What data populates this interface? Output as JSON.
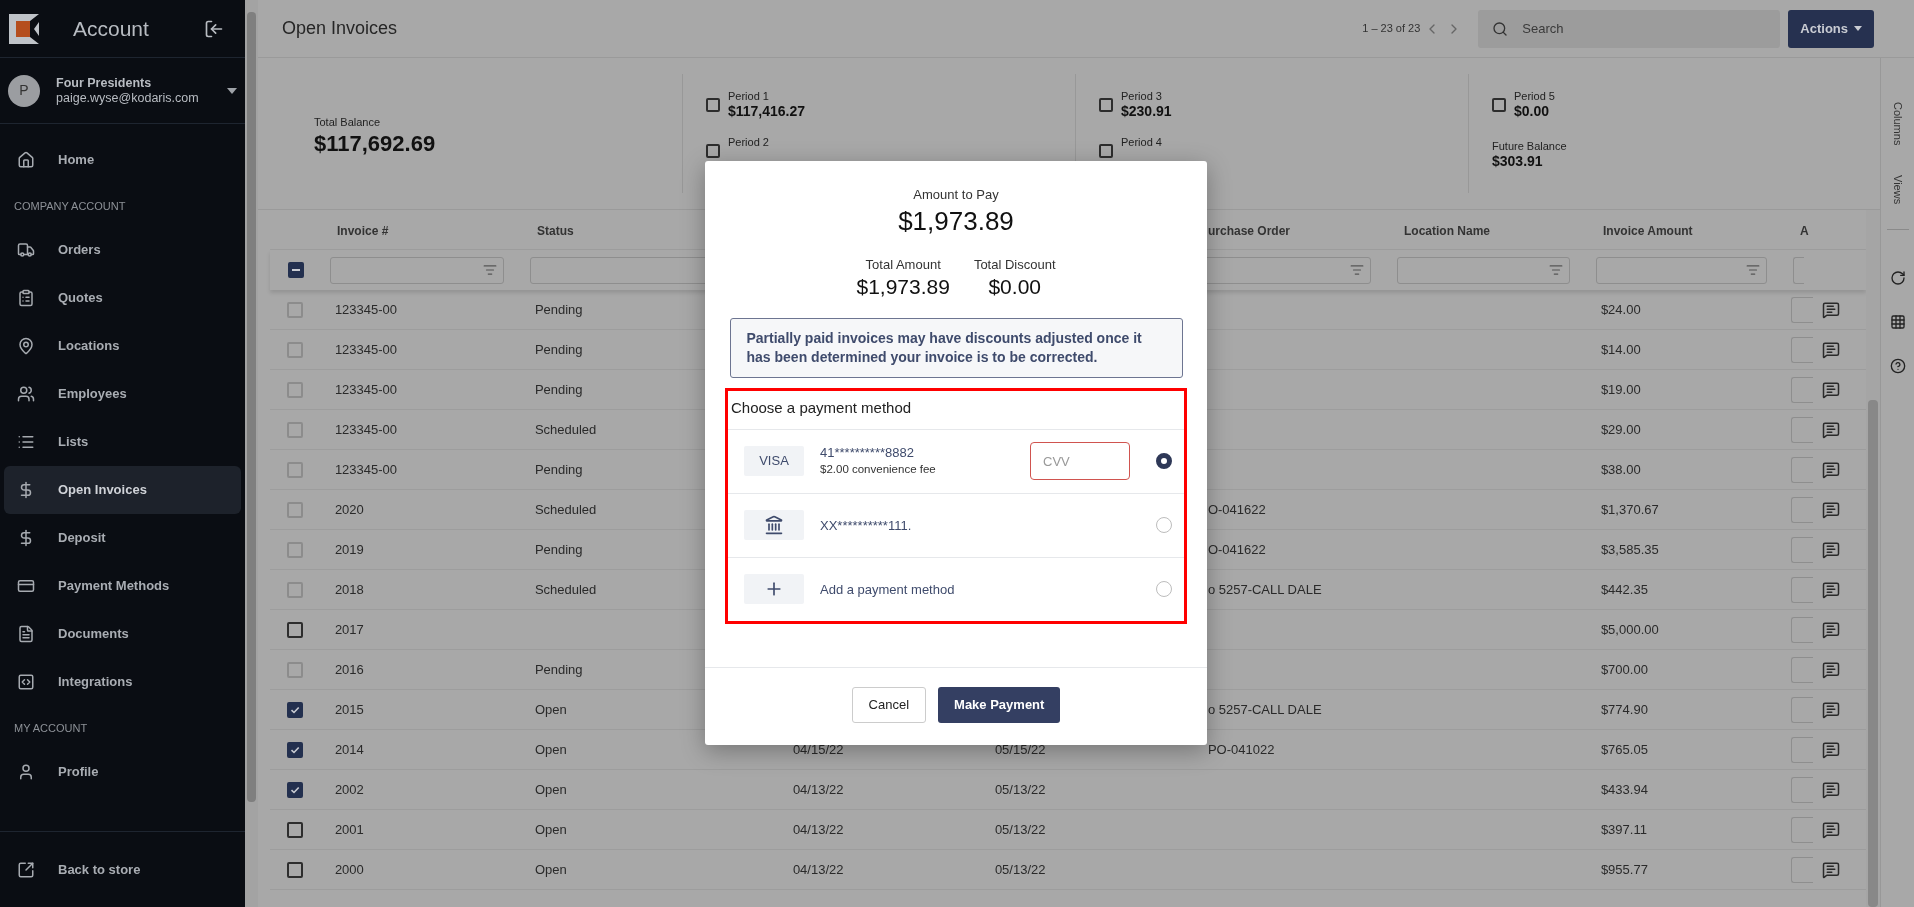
{
  "sidebar": {
    "title": "Account",
    "user": {
      "initial": "P",
      "name": "Four Presidents",
      "email": "paige.wyse@kodaris.com"
    },
    "sections": [
      {
        "items": [
          {
            "label": "Home",
            "selected": false
          }
        ]
      },
      {
        "heading": "COMPANY ACCOUNT",
        "items": [
          {
            "label": "Orders",
            "selected": false
          },
          {
            "label": "Quotes",
            "selected": false
          },
          {
            "label": "Locations",
            "selected": false
          },
          {
            "label": "Employees",
            "selected": false
          },
          {
            "label": "Lists",
            "selected": false
          },
          {
            "label": "Open Invoices",
            "selected": true
          },
          {
            "label": "Deposit",
            "selected": false
          },
          {
            "label": "Payment Methods",
            "selected": false
          },
          {
            "label": "Documents",
            "selected": false
          },
          {
            "label": "Integrations",
            "selected": false
          }
        ]
      },
      {
        "heading": "MY ACCOUNT",
        "items": [
          {
            "label": "Profile",
            "selected": false
          }
        ]
      }
    ],
    "footer": "Back to store"
  },
  "header": {
    "title": "Open Invoices",
    "pagination": "1 – 23 of 23",
    "search": {
      "placeholder": "Search"
    },
    "actions": "Actions"
  },
  "summary": {
    "total_balance": {
      "label": "Total Balance",
      "value": "$117,692.69"
    },
    "periods": [
      {
        "label": "Period 1",
        "value": "$117,416.27",
        "checked": false
      },
      {
        "label": "Period 2",
        "checked": false
      },
      {
        "label": "Period 3",
        "value": "$230.91",
        "checked": false
      },
      {
        "label": "Period 4",
        "checked": false
      },
      {
        "label": "Period 5",
        "value": "$0.00",
        "checked": false
      }
    ],
    "future_balance": {
      "label": "Future Balance",
      "value": "$303.91"
    }
  },
  "side_tabs": [
    "Columns",
    "Views"
  ],
  "table": {
    "select_all": {
      "indeterminate": true
    },
    "columns": [
      {
        "label": "Invoice #"
      },
      {
        "label": "Status"
      },
      {},
      {},
      {
        "label": "urchase Order"
      },
      {
        "label": "Location Name"
      },
      {
        "label": "Invoice Amount"
      },
      {
        "label": "A"
      }
    ],
    "rows": [
      {
        "checked": false,
        "disabled": true,
        "cells": {
          "invoice": "123345-00",
          "status": "Pending",
          "invoice_amount": "$24.00"
        }
      },
      {
        "checked": false,
        "disabled": true,
        "cells": {
          "invoice": "123345-00",
          "status": "Pending",
          "invoice_amount": "$14.00"
        }
      },
      {
        "checked": false,
        "disabled": true,
        "cells": {
          "invoice": "123345-00",
          "status": "Pending",
          "invoice_amount": "$19.00"
        }
      },
      {
        "checked": false,
        "disabled": true,
        "cells": {
          "invoice": "123345-00",
          "status": "Scheduled",
          "invoice_amount": "$29.00"
        }
      },
      {
        "checked": false,
        "disabled": true,
        "cells": {
          "invoice": "123345-00",
          "status": "Pending",
          "invoice_amount": "$38.00"
        }
      },
      {
        "checked": false,
        "disabled": true,
        "cells": {
          "invoice": "2020",
          "status": "Scheduled",
          "purchase_order": "O-041622",
          "invoice_amount": "$1,370.67"
        }
      },
      {
        "checked": false,
        "disabled": true,
        "cells": {
          "invoice": "2019",
          "status": "Pending",
          "purchase_order": "O-041622",
          "invoice_amount": "$3,585.35"
        }
      },
      {
        "checked": false,
        "disabled": true,
        "cells": {
          "invoice": "2018",
          "status": "Scheduled",
          "purchase_order": "o 5257-CALL DALE",
          "invoice_amount": "$442.35"
        }
      },
      {
        "checked": false,
        "disabled": false,
        "cells": {
          "invoice": "2017",
          "invoice_amount": "$5,000.00"
        }
      },
      {
        "checked": false,
        "disabled": true,
        "cells": {
          "invoice": "2016",
          "status": "Pending",
          "invoice_amount": "$700.00"
        }
      },
      {
        "checked": true,
        "disabled": false,
        "cells": {
          "invoice": "2015",
          "status": "Open",
          "purchase_order": "o 5257-CALL DALE",
          "invoice_amount": "$774.90"
        }
      },
      {
        "checked": true,
        "disabled": false,
        "cells": {
          "invoice": "2014",
          "status": "Open",
          "date_1": "04/15/22",
          "date_2": "05/15/22",
          "purchase_order": "PO-041022",
          "invoice_amount": "$765.05"
        }
      },
      {
        "checked": true,
        "disabled": false,
        "cells": {
          "invoice": "2002",
          "status": "Open",
          "date_1": "04/13/22",
          "date_2": "05/13/22",
          "invoice_amount": "$433.94"
        }
      },
      {
        "checked": false,
        "disabled": false,
        "cells": {
          "invoice": "2001",
          "status": "Open",
          "date_1": "04/13/22",
          "date_2": "05/13/22",
          "invoice_amount": "$397.11"
        }
      },
      {
        "checked": false,
        "disabled": false,
        "cells": {
          "invoice": "2000",
          "status": "Open",
          "date_1": "04/13/22",
          "date_2": "05/13/22",
          "invoice_amount": "$955.77"
        }
      }
    ]
  },
  "modal": {
    "amount_label": "Amount to Pay",
    "amount": "$1,973.89",
    "totals": [
      {
        "label": "Total Amount",
        "value": "$1,973.89"
      },
      {
        "label": "Total Discount",
        "value": "$0.00"
      }
    ],
    "notice": "Partially paid invoices may have discounts adjusted once it has been determined your invoice is to be corrected.",
    "methods_heading": "Choose a payment method",
    "methods": [
      {
        "kind": "card",
        "badge": "VISA",
        "number": "41**********8882",
        "fee": "$2.00 convenience fee",
        "cvv_placeholder": "CVV",
        "selected": true
      },
      {
        "kind": "bank",
        "number": "XX**********111.",
        "selected": false
      },
      {
        "kind": "add",
        "label": "Add a payment method",
        "selected": false
      }
    ],
    "buttons": [
      {
        "kind": "secondary",
        "label": "Cancel"
      },
      {
        "kind": "primary",
        "label": "Make Payment"
      }
    ]
  }
}
